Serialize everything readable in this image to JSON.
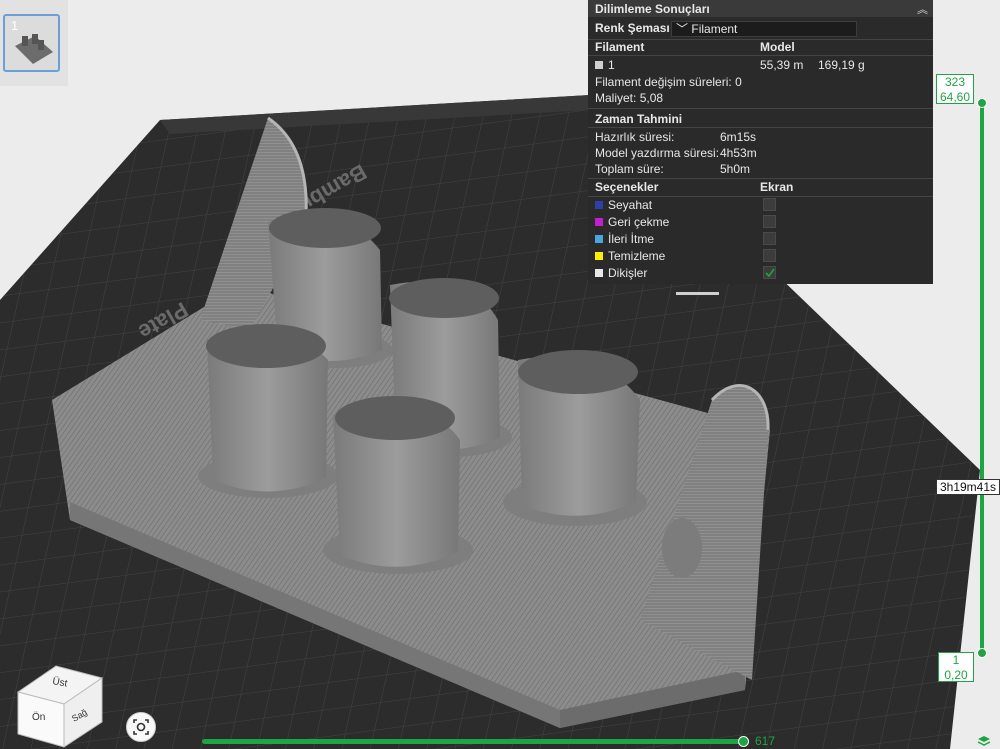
{
  "thumbnail": {
    "plate_number": "1"
  },
  "panel": {
    "title": "Dilimleme Sonuçları",
    "color_scheme_label": "Renk Şeması",
    "color_scheme_value": "Filament",
    "filament_header": "Filament",
    "model_header": "Model",
    "filament_row": {
      "id": "1",
      "length": "55,39 m",
      "weight": "169,19 g"
    },
    "change_time_label": "Filament değişim süreleri:",
    "change_time_value": "0",
    "cost_label": "Maliyet:",
    "cost_value": "5,08",
    "time_section": "Zaman Tahmini",
    "prep_label": "Hazırlık süresi:",
    "prep_value": "6m15s",
    "print_label": "Model yazdırma süresi:",
    "print_value": "4h53m",
    "total_label": "Toplam süre:",
    "total_value": "5h0m",
    "options_header": "Seçenekler",
    "display_header": "Ekran",
    "options": [
      {
        "label": "Seyahat",
        "color": "#2d3fa8",
        "checked": false
      },
      {
        "label": "Geri çekme",
        "color": "#c21fcf",
        "checked": false
      },
      {
        "label": "İleri İtme",
        "color": "#49a8e0",
        "checked": false
      },
      {
        "label": "Temizleme",
        "color": "#ffee00",
        "checked": false
      },
      {
        "label": "Dikişler",
        "color": "#e8e8e8",
        "checked": true
      }
    ]
  },
  "layer_slider": {
    "top_layer": "323",
    "top_height": "64,60",
    "bottom_layer": "1",
    "bottom_height": "0,20",
    "time": "3h19m41s"
  },
  "move_slider": {
    "value": "617"
  },
  "view_cube": {
    "top": "Üst",
    "front": "Ön",
    "right": "Sağ"
  },
  "bed_text": {
    "brand": "Bambu",
    "plate": "Plate"
  },
  "colors": {
    "accent": "#1fa443",
    "panel_bg": "#2a2a2a",
    "model": "#8a8a8a",
    "bed": "#2e2e2e"
  }
}
